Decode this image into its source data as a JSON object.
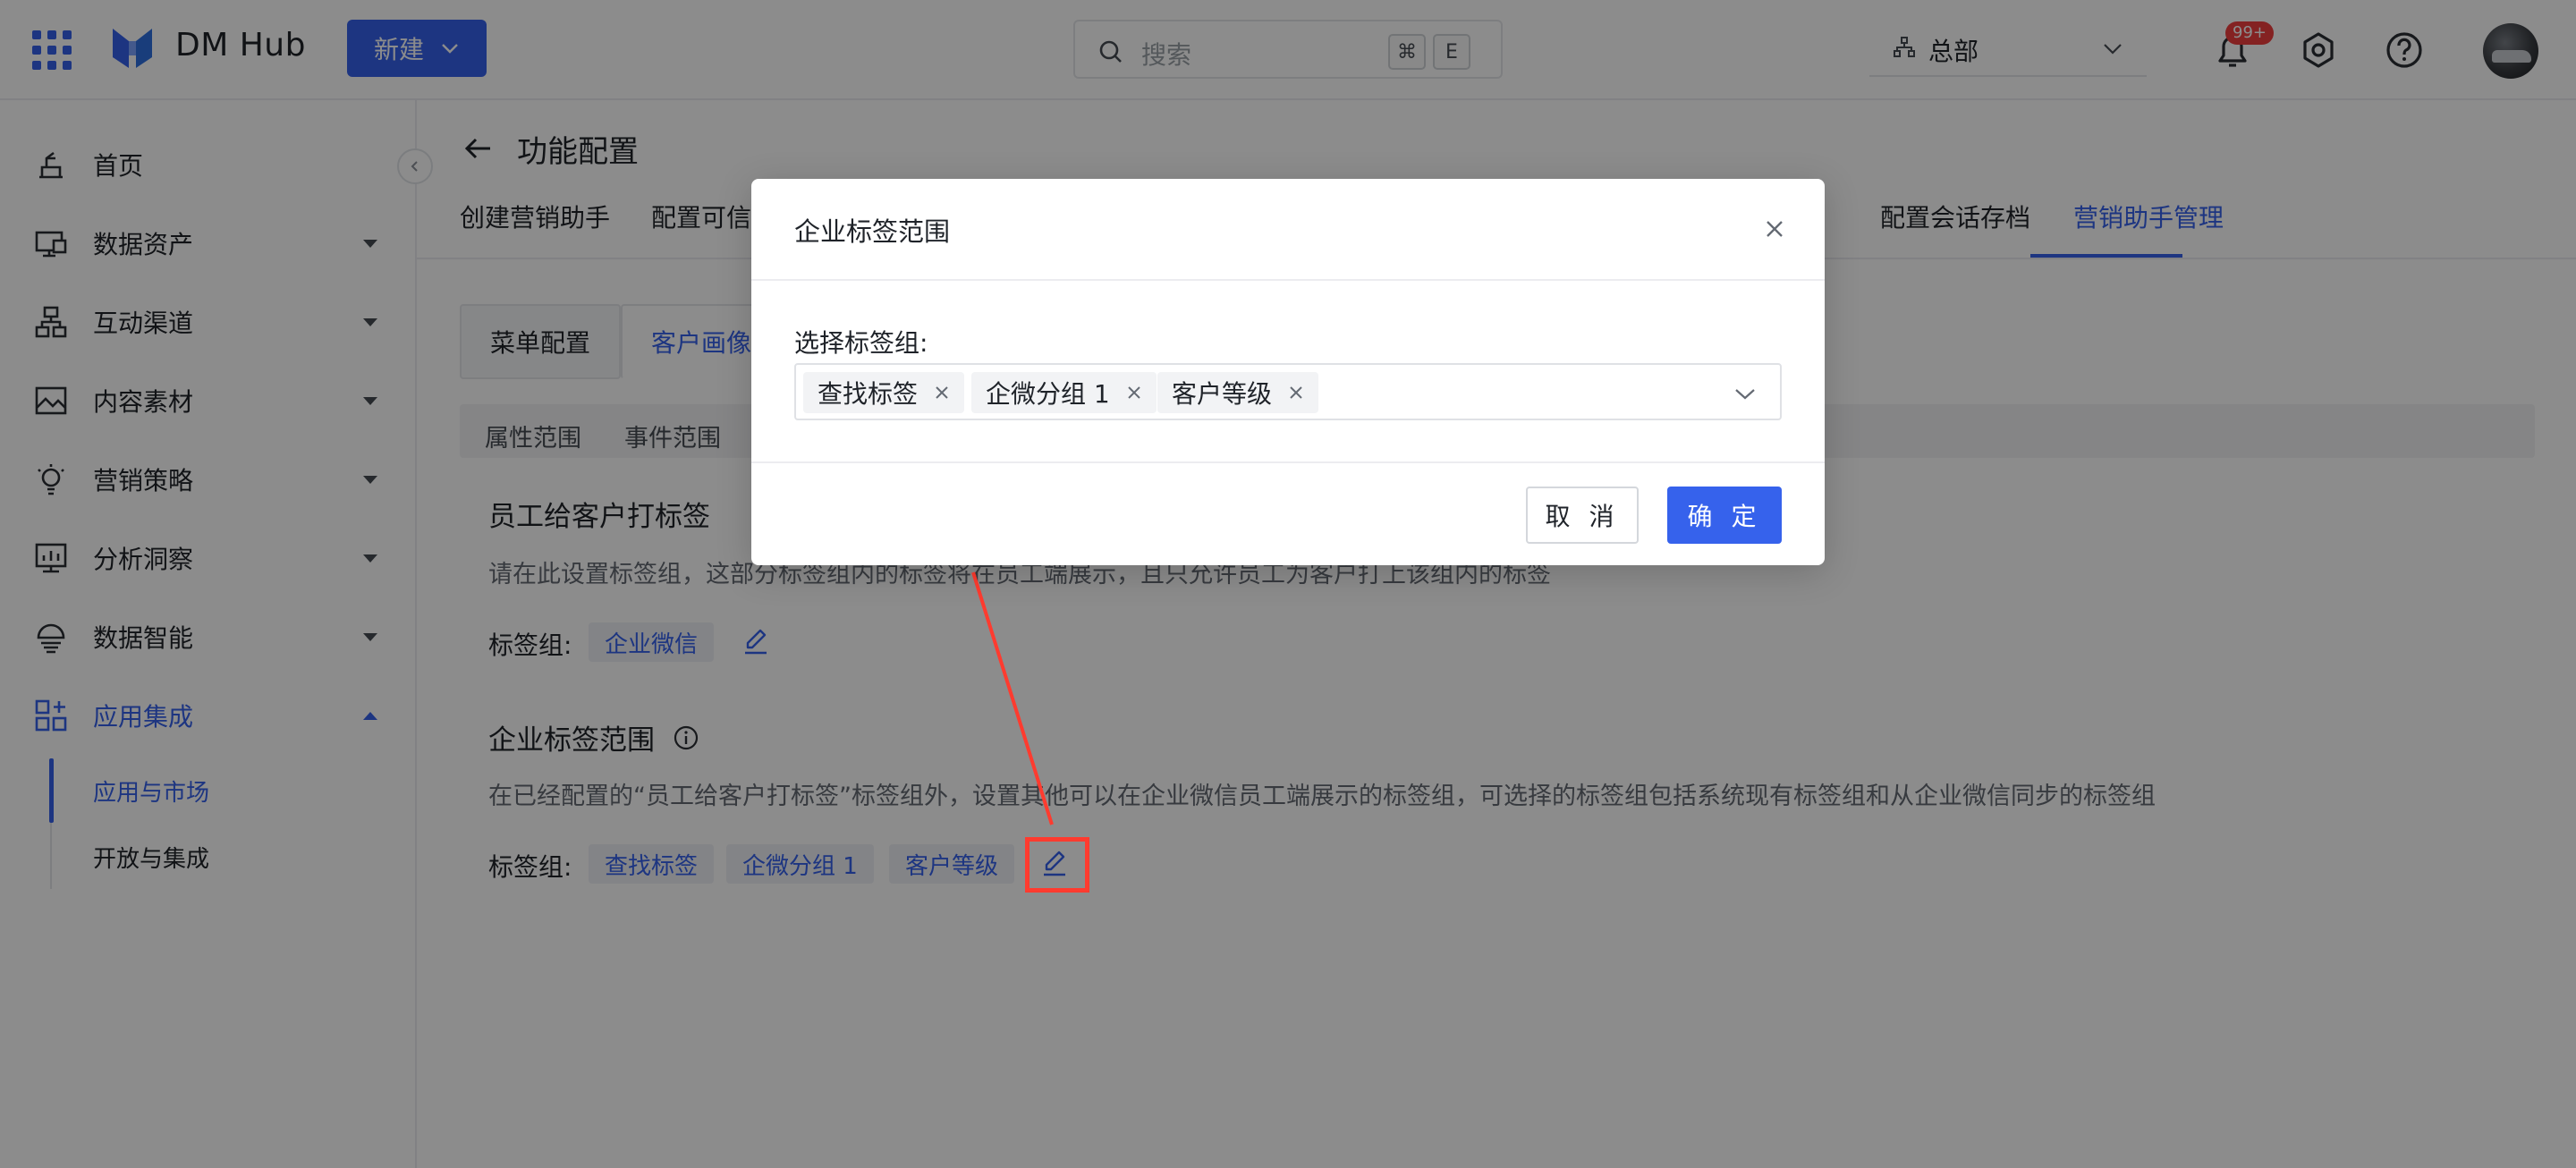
{
  "topbar": {
    "brand": "DM Hub",
    "new_label": "新建",
    "search_placeholder": "搜索",
    "shortcut_keys": [
      "⌘",
      "E"
    ],
    "org_name": "总部",
    "notification_badge": "99+"
  },
  "sidebar": {
    "items": [
      {
        "label": "首页",
        "icon": "home-icon"
      },
      {
        "label": "数据资产",
        "icon": "data-assets-icon"
      },
      {
        "label": "互动渠道",
        "icon": "channels-icon"
      },
      {
        "label": "内容素材",
        "icon": "content-icon"
      },
      {
        "label": "营销策略",
        "icon": "strategy-icon"
      },
      {
        "label": "分析洞察",
        "icon": "analytics-icon"
      },
      {
        "label": "数据智能",
        "icon": "intelligence-icon"
      },
      {
        "label": "应用集成",
        "icon": "apps-integration-icon"
      }
    ],
    "sub_items": [
      {
        "label": "应用与市场"
      },
      {
        "label": "开放与集成"
      }
    ]
  },
  "page": {
    "title": "功能配置",
    "tabs": [
      "创建营销助手",
      "配置可信",
      "配置会话存档",
      "营销助手管理"
    ],
    "subtabs": [
      "菜单配置",
      "客户画像"
    ],
    "filters": [
      "属性范围",
      "事件范围"
    ]
  },
  "section1": {
    "title": "员工给客户打标签",
    "desc": "请在此设置标签组，这部分标签组内的标签将在员工端展示，且只允许员工为客户打上该组内的标签",
    "tag_label": "标签组:",
    "tags": [
      "企业微信"
    ]
  },
  "section2": {
    "title": "企业标签范围",
    "desc": "在已经配置的“员工给客户打标签”标签组外，设置其他可以在企业微信员工端展示的标签组，可选择的标签组包括系统现有标签组和从企业微信同步的标签组",
    "tag_label": "标签组:",
    "tags": [
      "查找标签",
      "企微分组 1",
      "客户等级"
    ]
  },
  "modal": {
    "title": "企业标签范围",
    "field_label": "选择标签组:",
    "selected": [
      "查找标签",
      "企微分组 1",
      "客户等级"
    ],
    "cancel_label": "取 消",
    "ok_label": "确 定"
  },
  "colors": {
    "accent": "#3662ec",
    "annotation": "#ff3b2f"
  }
}
